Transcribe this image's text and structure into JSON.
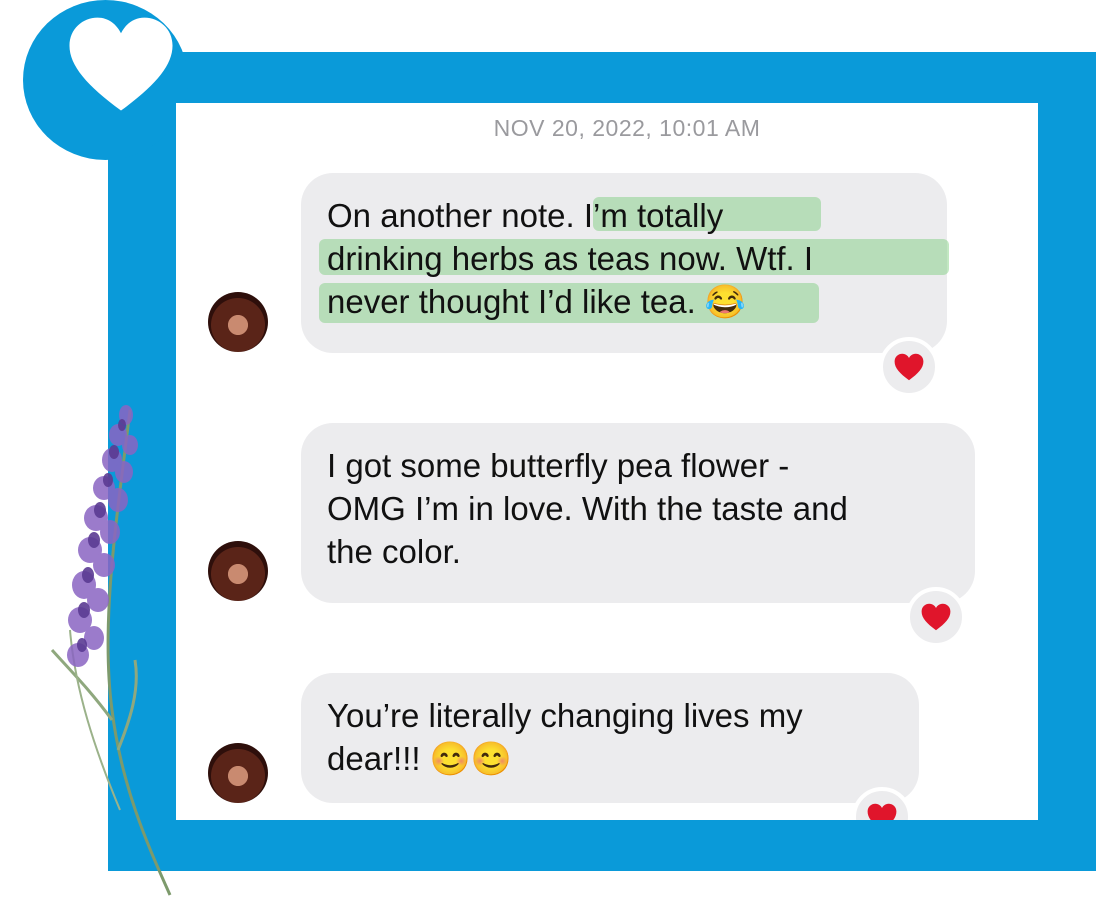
{
  "timestamp": "NOV 20, 2022, 10:01 AM",
  "messages": [
    {
      "lines": [
        "On another note.  I’m totally",
        "drinking herbs as teas now.  Wtf.  I",
        "never thought I’d like tea. 😂"
      ],
      "reaction": "heart"
    },
    {
      "lines": [
        "I got some butterfly pea flower -",
        "OMG I’m in love.  With the taste and",
        "the color."
      ],
      "reaction": "heart"
    },
    {
      "lines": [
        "You’re literally changing lives my",
        "dear!!! 😊😊"
      ],
      "reaction": "heart"
    }
  ],
  "colors": {
    "frame": "#0a9ad9",
    "bubble": "#ececee",
    "timestamp": "#9a9a9e",
    "highlight": "#78cd78",
    "reaction_heart": "#e0152b"
  },
  "icons": {
    "badge": "heart-icon",
    "reaction": "red-heart-icon"
  }
}
